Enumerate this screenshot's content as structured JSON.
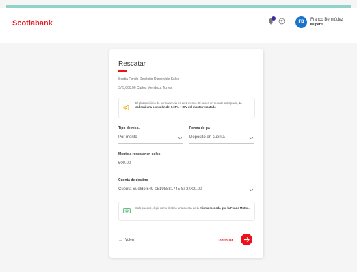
{
  "header": {
    "logo": "Scotiabank",
    "avatar_initials": "FB",
    "user_name": "Franco Bermúdez",
    "user_link": "Mi perfil",
    "accent": "#ec111a"
  },
  "card": {
    "title": "Rescatar",
    "fund_name": "Scotia Fondo Depósito Disponible Soles",
    "fund_amount": "S/ 5,000.00 Carlos Mendoza Torres",
    "note": {
      "text_normal": "El plazo mínimo de permanencia es de 2 meses. Si haces un rescate anticipado,",
      "text_bold": "se cobrará una comisión del 0.95% + IGV del monto rescatado",
      "icon": "megaphone-icon"
    },
    "rescue_type": {
      "label": "Tipo de resc.",
      "value": "Por monto"
    },
    "payment": {
      "label": "Forma de pa",
      "value": "Depósito en cuenta"
    },
    "amount": {
      "label": "Monto a rescatar en soles",
      "value": "500.00"
    },
    "account": {
      "label": "Cuenta de destino",
      "value": "Cuenta Sueldo 549-05198881745  S/ 2,000.00"
    },
    "note2": {
      "text_normal": "Solo puedes elegir como destino una cuenta de la",
      "text_bold": "misma moneda que la Fondo Mutuo.",
      "icon": "money-icon"
    },
    "back_label": "Volver",
    "continue_label": "Continuar"
  }
}
